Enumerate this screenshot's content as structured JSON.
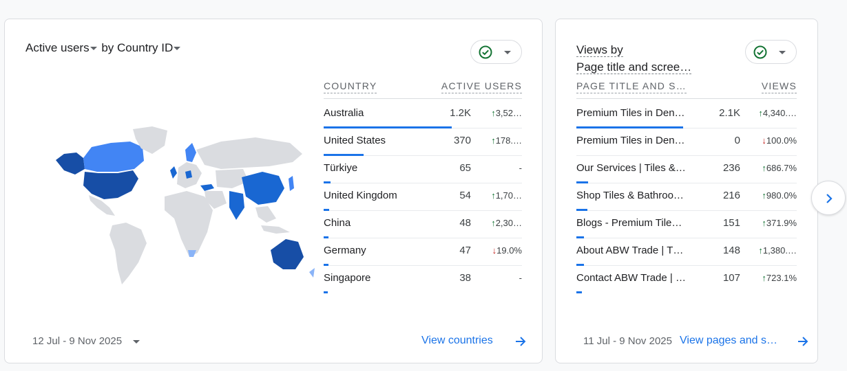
{
  "card1": {
    "metric": "Active users",
    "by": "by",
    "dimension": "Country ID",
    "col_country": "COUNTRY",
    "col_users": "ACTIVE USERS",
    "rows": [
      {
        "label": "Australia",
        "value": "1.2K",
        "change": "3,52…",
        "dir": "up",
        "share": 1.0
      },
      {
        "label": "United States",
        "value": "370",
        "change": "178.…",
        "dir": "up",
        "share": 0.31
      },
      {
        "label": "Türkiye",
        "value": "65",
        "change": "-",
        "dir": "none",
        "share": 0.055
      },
      {
        "label": "United Kingdom",
        "value": "54",
        "change": "1,70…",
        "dir": "up",
        "share": 0.045
      },
      {
        "label": "China",
        "value": "48",
        "change": "2,30…",
        "dir": "up",
        "share": 0.04
      },
      {
        "label": "Germany",
        "value": "47",
        "change": "19.0%",
        "dir": "down",
        "share": 0.039
      },
      {
        "label": "Singapore",
        "value": "38",
        "change": "-",
        "dir": "none",
        "share": 0.032
      }
    ],
    "date": "12 Jul - 9 Nov 2025",
    "link": "View countries"
  },
  "card2": {
    "title_line1": "Views by",
    "title_line2": "Page title and scree…",
    "col_page": "PAGE TITLE AND S…",
    "col_views": "VIEWS",
    "rows": [
      {
        "label": "Premium Tiles in Den…",
        "value": "2.1K",
        "change": "4,340.…",
        "dir": "up",
        "share": 1.0
      },
      {
        "label": "Premium Tiles in Den…",
        "value": "0",
        "change": "100.0%",
        "dir": "down",
        "share": 0.0
      },
      {
        "label": "Our Services | Tiles &…",
        "value": "236",
        "change": "686.7%",
        "dir": "up",
        "share": 0.11
      },
      {
        "label": "Shop Tiles & Bathroo…",
        "value": "216",
        "change": "980.0%",
        "dir": "up",
        "share": 0.1
      },
      {
        "label": "Blogs - Premium Tile…",
        "value": "151",
        "change": "371.9%",
        "dir": "up",
        "share": 0.07
      },
      {
        "label": "About ABW Trade | T…",
        "value": "148",
        "change": "1,380.…",
        "dir": "up",
        "share": 0.07
      },
      {
        "label": "Contact ABW Trade | …",
        "value": "107",
        "change": "723.1%",
        "dir": "up",
        "share": 0.05
      }
    ],
    "date": "11 Jul - 9 Nov 2025",
    "link": "View pages and s…"
  },
  "colors": {
    "accent": "#1a73e8",
    "up": "#137333",
    "down": "#c5221f",
    "map_dark": "#174ea6",
    "map_mid": "#1967d2",
    "map_light": "#4285f4",
    "map_pale": "#8ab4f8",
    "map_none": "#dadce0"
  },
  "icons": {
    "check": "check-circle-icon",
    "caret": "caret-down-icon",
    "arrow": "arrow-right-icon",
    "next": "chevron-right-icon"
  }
}
